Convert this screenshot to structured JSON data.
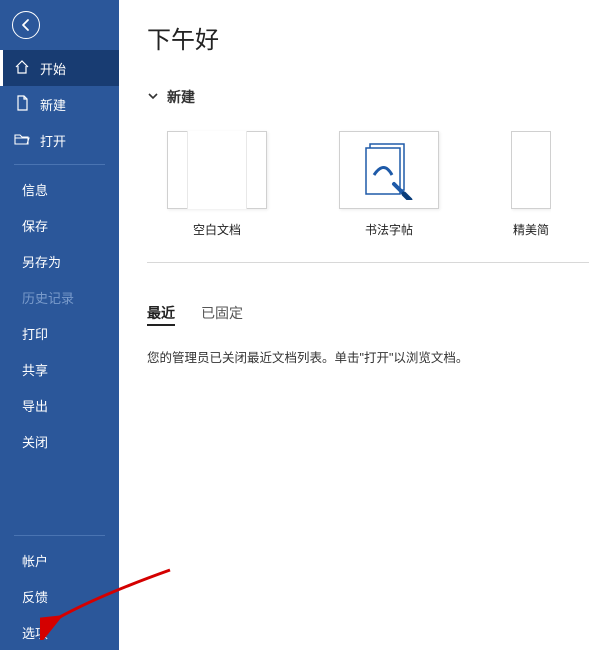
{
  "sidebar": {
    "back_aria": "返回",
    "items": [
      {
        "label": "开始",
        "icon": "home"
      },
      {
        "label": "新建",
        "icon": "file"
      },
      {
        "label": "打开",
        "icon": "folder"
      }
    ],
    "secondary": [
      {
        "label": "信息"
      },
      {
        "label": "保存"
      },
      {
        "label": "另存为"
      },
      {
        "label": "历史记录",
        "disabled": true
      },
      {
        "label": "打印"
      },
      {
        "label": "共享"
      },
      {
        "label": "导出"
      },
      {
        "label": "关闭"
      }
    ],
    "bottom": [
      {
        "label": "帐户"
      },
      {
        "label": "反馈"
      },
      {
        "label": "选项"
      }
    ]
  },
  "main": {
    "greeting": "下午好",
    "new_section": "新建",
    "templates": [
      {
        "label": "空白文档"
      },
      {
        "label": "书法字帖"
      },
      {
        "label": "精美简"
      }
    ],
    "tabs": {
      "recent": "最近",
      "pinned": "已固定"
    },
    "recent_message": "您的管理员已关闭最近文档列表。单击\"打开\"以浏览文档。"
  }
}
